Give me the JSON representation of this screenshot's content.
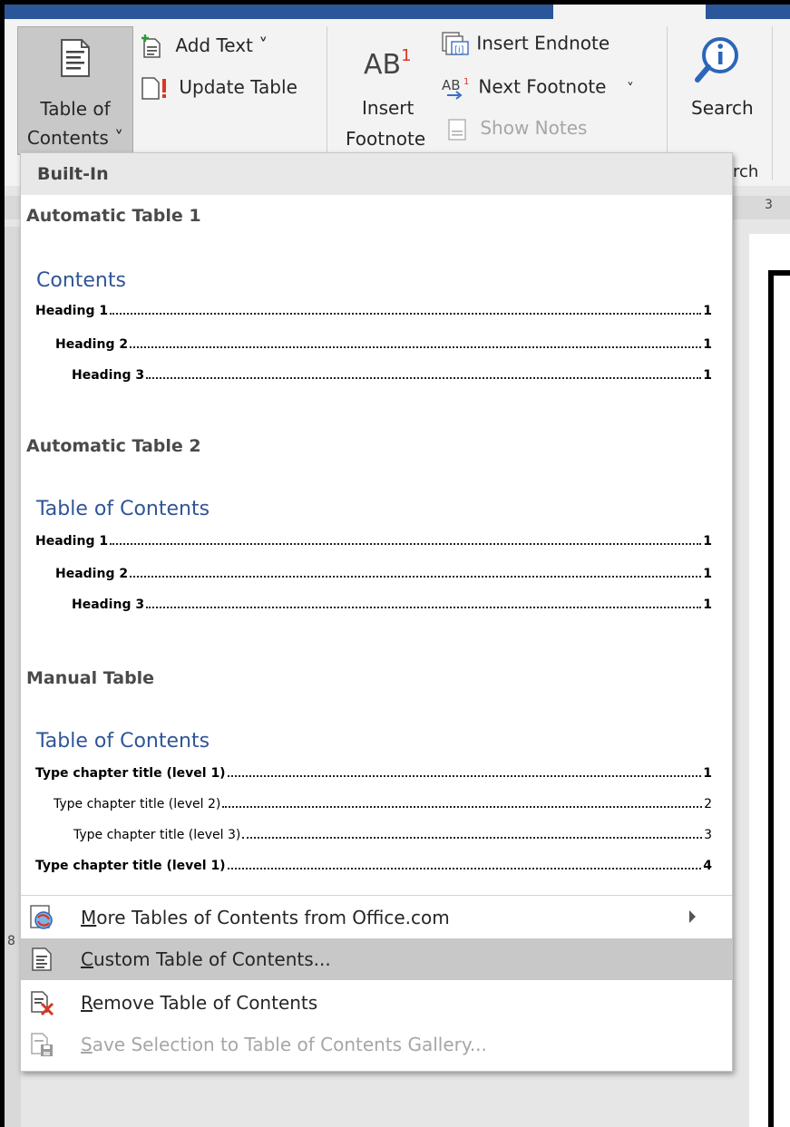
{
  "ribbon": {
    "toc_label_1": "Table of",
    "toc_label_2": "Contents ˅",
    "add_text": "Add Text ˅",
    "update_table": "Update Table",
    "insert_label_1": "Insert",
    "insert_label_2": "Footnote",
    "ab_glyph": "AB",
    "ab_sup": "1",
    "insert_endnote": "Insert Endnote",
    "next_footnote": "Next Footnote",
    "next_footnote_arrow": "˅",
    "show_notes": "Show Notes",
    "search": "Search",
    "group_partial": "rch"
  },
  "ruler": {
    "top_num": "3",
    "left_num": "8"
  },
  "dropdown": {
    "section_header": "Built-In",
    "galleries": [
      {
        "title": "Automatic Table 1",
        "heading": "Contents",
        "lines": [
          {
            "text": "Heading 1",
            "page": "1"
          },
          {
            "text": "Heading 2",
            "page": "1"
          },
          {
            "text": "Heading 3",
            "page": "1"
          }
        ]
      },
      {
        "title": "Automatic Table 2",
        "heading": "Table of Contents",
        "lines": [
          {
            "text": "Heading 1",
            "page": "1"
          },
          {
            "text": "Heading 2",
            "page": "1"
          },
          {
            "text": "Heading 3",
            "page": "1"
          }
        ]
      },
      {
        "title": "Manual Table",
        "heading": "Table of Contents",
        "lines": [
          {
            "text": "Type chapter title (level 1)",
            "page": "1"
          },
          {
            "text": "Type chapter title (level 2)",
            "page": "2"
          },
          {
            "text": "Type chapter title (level 3)",
            "page": "3"
          },
          {
            "text": "Type chapter title (level 1)",
            "page": "4"
          }
        ]
      }
    ],
    "menu": {
      "more": {
        "accel": "M",
        "rest": "ore Tables of Contents from Office.com",
        "icon": "globe-refresh-icon"
      },
      "custom": {
        "accel": "C",
        "rest": "ustom Table of Contents...",
        "icon": "document-list-icon"
      },
      "remove": {
        "accel": "R",
        "rest": "emove Table of Contents",
        "icon": "document-delete-icon"
      },
      "save": {
        "accel": "S",
        "rest": "ave Selection to Table of Contents Gallery...",
        "icon": "save-to-gallery-icon"
      }
    }
  },
  "colors": {
    "title_blue": "#2b579a",
    "toc_heading_blue": "#2f5597",
    "hover_gray": "#c8c8c8"
  }
}
